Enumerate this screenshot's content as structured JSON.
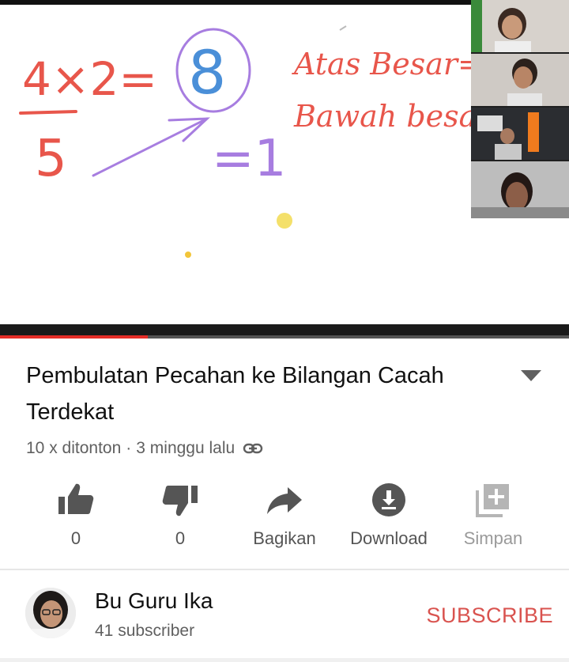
{
  "video": {
    "board": {
      "equation_top": "4×2=",
      "answer": "8",
      "denominator": "5",
      "equals_one": "=1",
      "note_line1": "Atas Besar=",
      "note_line2": "Bawah besar="
    },
    "progress": {
      "played_fraction": 0.26
    }
  },
  "info": {
    "title": "Pembulatan Pecahan ke Bilangan Cacah Terdekat",
    "views": "10 x ditonton",
    "separator": "·",
    "age": "3 minggu lalu"
  },
  "actions": {
    "like_count": "0",
    "dislike_count": "0",
    "share_label": "Bagikan",
    "download_label": "Download",
    "save_label": "Simpan"
  },
  "channel": {
    "name": "Bu Guru Ika",
    "subscribers": "41 subscriber",
    "subscribe_label": "SUBSCRIBE"
  },
  "colors": {
    "accent": "#e52d27",
    "subscribe": "#d9534f",
    "ink_red": "#e8564b",
    "ink_blue": "#4a8fd8",
    "ink_purple": "#a77de0"
  }
}
